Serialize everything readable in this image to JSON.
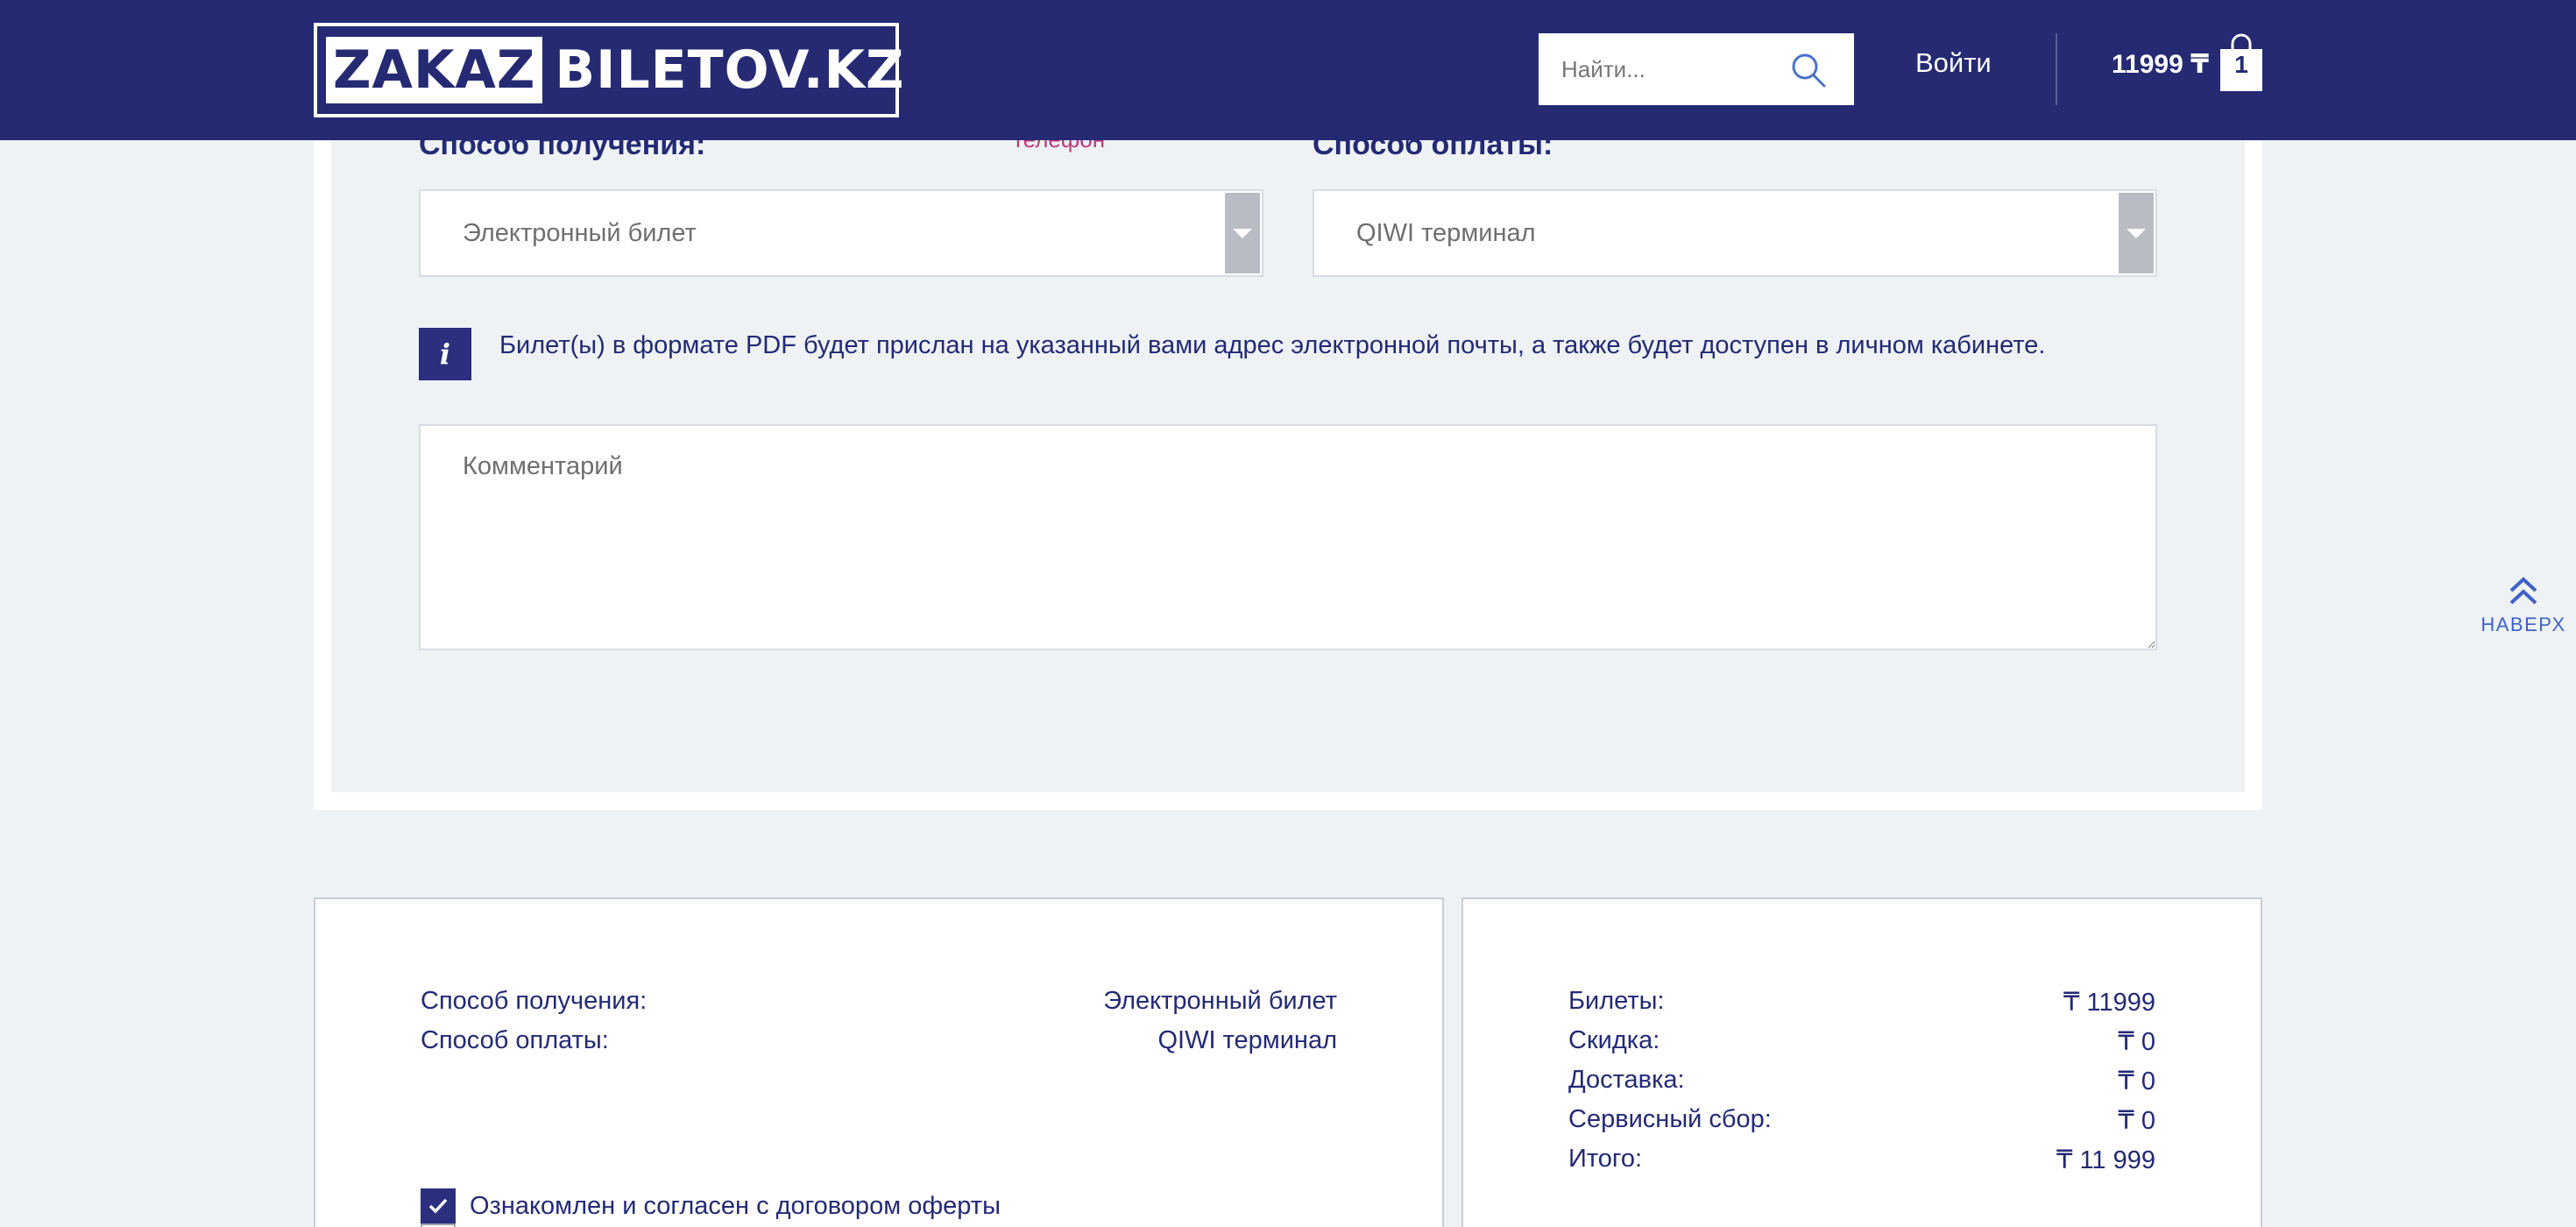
{
  "header": {
    "logo_part1": "ZAKAZ",
    "logo_part2": "BILETOV.KZ",
    "search_placeholder": "Найти...",
    "login": "Войти",
    "cart_total": "11999 ₸",
    "cart_count": "1",
    "colors": {
      "bar": "#252a73",
      "accent": "#4060c8"
    }
  },
  "form": {
    "peek_link": "телефон",
    "delivery_label": "Способ получения:",
    "delivery_value": "Электронный билет",
    "payment_label": "Способ оплаты:",
    "payment_value": "QIWI терминал",
    "info_icon": "i",
    "info_text": "Билет(ы) в формате PDF будет прислан на указанный вами адрес электронной почты, а также будет доступен в личном кабинете.",
    "comment_placeholder": "Комментарий"
  },
  "to_top": {
    "label": "НАВЕРХ"
  },
  "summary_left": {
    "rows": [
      {
        "label": "Способ получения:",
        "value": "Электронный билет"
      },
      {
        "label": "Способ оплаты:",
        "value": "QIWI терминал"
      }
    ],
    "agree_text": "Ознакомлен и согласен с",
    "agree_link": "договором оферты"
  },
  "summary_right": {
    "rows": [
      {
        "label": "Билеты:",
        "value": "₸ 11999"
      },
      {
        "label": "Скидка:",
        "value": "₸ 0"
      },
      {
        "label": "Доставка:",
        "value": "₸ 0"
      },
      {
        "label": "Сервисный сбор:",
        "value": "₸ 0"
      },
      {
        "label": "Итого:",
        "value": "₸ 11 999"
      }
    ]
  }
}
